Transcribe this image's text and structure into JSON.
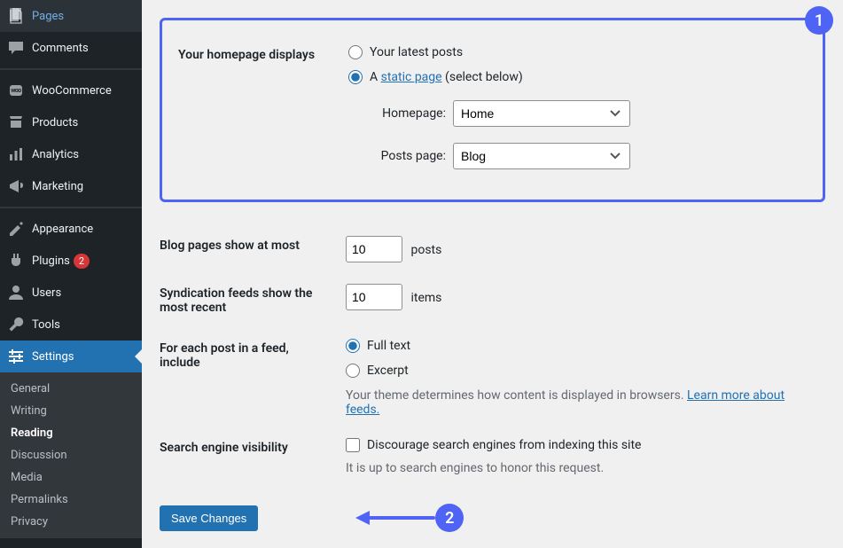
{
  "sidebar": {
    "items": [
      {
        "label": "Pages",
        "icon": "pages"
      },
      {
        "label": "Comments",
        "icon": "comments"
      },
      {
        "label": "WooCommerce",
        "icon": "woo"
      },
      {
        "label": "Products",
        "icon": "products"
      },
      {
        "label": "Analytics",
        "icon": "analytics"
      },
      {
        "label": "Marketing",
        "icon": "marketing"
      },
      {
        "label": "Appearance",
        "icon": "appearance"
      },
      {
        "label": "Plugins",
        "icon": "plugins",
        "badge": "2"
      },
      {
        "label": "Users",
        "icon": "users"
      },
      {
        "label": "Tools",
        "icon": "tools"
      },
      {
        "label": "Settings",
        "icon": "settings"
      }
    ],
    "submenu": [
      {
        "label": "General"
      },
      {
        "label": "Writing"
      },
      {
        "label": "Reading",
        "current": true
      },
      {
        "label": "Discussion"
      },
      {
        "label": "Media"
      },
      {
        "label": "Permalinks"
      },
      {
        "label": "Privacy"
      }
    ]
  },
  "settings": {
    "homepage_heading": "Your homepage displays",
    "latest_posts": "Your latest posts",
    "static_page_prefix": "A ",
    "static_page_link": "static page",
    "static_page_suffix": " (select below)",
    "homepage_label": "Homepage:",
    "posts_page_label": "Posts page:",
    "homepage_value": "Home",
    "postspage_value": "Blog",
    "blog_pages_heading": "Blog pages show at most",
    "blog_pages_value": "10",
    "posts_suffix": "posts",
    "syndication_heading": "Syndication feeds show the most recent",
    "syndication_value": "10",
    "items_suffix": "items",
    "feed_heading": "For each post in a feed, include",
    "fulltext": "Full text",
    "excerpt": "Excerpt",
    "feed_desc_prefix": "Your theme determines how content is displayed in browsers. ",
    "learn_more": "Learn more about feeds.",
    "search_heading": "Search engine visibility",
    "discourage": "Discourage search engines from indexing this site",
    "honor": "It is up to search engines to honor this request.",
    "save": "Save Changes"
  },
  "callouts": {
    "one": "1",
    "two": "2"
  }
}
